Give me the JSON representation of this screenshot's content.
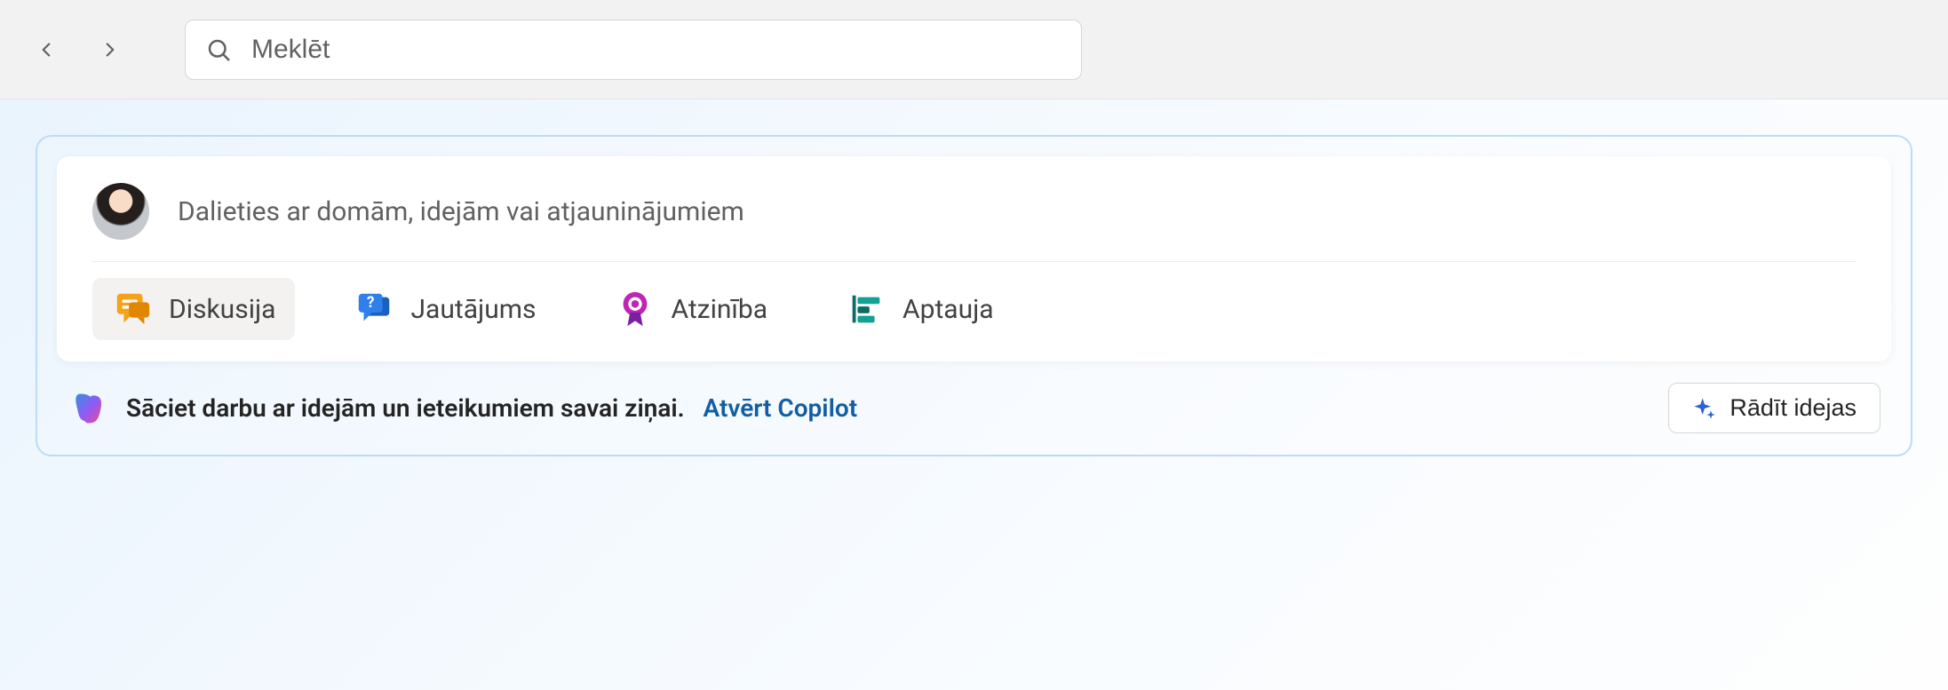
{
  "search": {
    "placeholder": "Meklēt",
    "value": ""
  },
  "composer": {
    "prompt": "Dalieties ar domām, idejām vai atjauninājumiem"
  },
  "tabs": {
    "discussion": "Diskusija",
    "question": "Jautājums",
    "praise": "Atzinība",
    "poll": "Aptauja"
  },
  "copilot": {
    "lead": "Sāciet darbu ar idejām un ieteikumiem savai ziņai.",
    "link": "Atvērt Copilot",
    "button": "Rādīt idejas"
  }
}
